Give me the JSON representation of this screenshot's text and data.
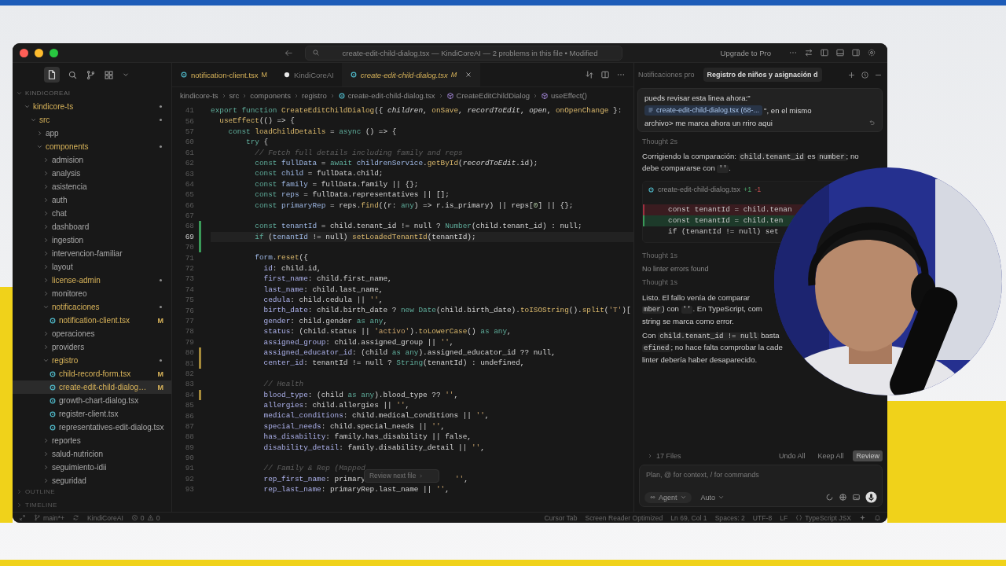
{
  "window": {
    "title": "create-edit-child-dialog.tsx — KindiCoreAI — 2 problems in this file • Modified",
    "upgrade_label": "Upgrade to Pro"
  },
  "explorer": {
    "title": "KINDICOREAI",
    "tree": [
      {
        "name": "kindicore-ts",
        "kind": "folder",
        "expanded": true,
        "modified": true,
        "selected": false,
        "children": [
          {
            "name": "src",
            "kind": "folder",
            "expanded": true,
            "modified": true,
            "selected": false,
            "children": [
              {
                "name": "app",
                "kind": "folder",
                "expanded": false,
                "modified": false,
                "selected": false
              },
              {
                "name": "components",
                "kind": "folder",
                "expanded": true,
                "modified": true,
                "selected": false,
                "children": [
                  {
                    "name": "admision",
                    "kind": "folder",
                    "expanded": false,
                    "modified": false,
                    "selected": false
                  },
                  {
                    "name": "analysis",
                    "kind": "folder",
                    "expanded": false,
                    "modified": false,
                    "selected": false
                  },
                  {
                    "name": "asistencia",
                    "kind": "folder",
                    "expanded": false,
                    "modified": false,
                    "selected": false
                  },
                  {
                    "name": "auth",
                    "kind": "folder",
                    "expanded": false,
                    "modified": false,
                    "selected": false
                  },
                  {
                    "name": "chat",
                    "kind": "folder",
                    "expanded": false,
                    "modified": false,
                    "selected": false
                  },
                  {
                    "name": "dashboard",
                    "kind": "folder",
                    "expanded": false,
                    "modified": false,
                    "selected": false
                  },
                  {
                    "name": "ingestion",
                    "kind": "folder",
                    "expanded": false,
                    "modified": false,
                    "selected": false
                  },
                  {
                    "name": "intervencion-familiar",
                    "kind": "folder",
                    "expanded": false,
                    "modified": false,
                    "selected": false
                  },
                  {
                    "name": "layout",
                    "kind": "folder",
                    "expanded": false,
                    "modified": false,
                    "selected": false
                  },
                  {
                    "name": "license-admin",
                    "kind": "folder",
                    "expanded": false,
                    "modified": true,
                    "selected": false
                  },
                  {
                    "name": "monitoreo",
                    "kind": "folder",
                    "expanded": false,
                    "modified": false,
                    "selected": false
                  },
                  {
                    "name": "notificaciones",
                    "kind": "folder",
                    "expanded": true,
                    "modified": true,
                    "selected": false,
                    "children": [
                      {
                        "name": "notification-client.tsx",
                        "kind": "file",
                        "modified": true,
                        "badge": "M",
                        "selected": false
                      }
                    ]
                  },
                  {
                    "name": "operaciones",
                    "kind": "folder",
                    "expanded": false,
                    "modified": false,
                    "selected": false
                  },
                  {
                    "name": "providers",
                    "kind": "folder",
                    "expanded": false,
                    "modified": false,
                    "selected": false
                  },
                  {
                    "name": "registro",
                    "kind": "folder",
                    "expanded": true,
                    "modified": true,
                    "selected": false,
                    "children": [
                      {
                        "name": "child-record-form.tsx",
                        "kind": "file",
                        "modified": true,
                        "badge": "M",
                        "selected": false
                      },
                      {
                        "name": "create-edit-child-dialog…",
                        "kind": "file",
                        "modified": true,
                        "badge": "M",
                        "selected": true
                      },
                      {
                        "name": "growth-chart-dialog.tsx",
                        "kind": "file",
                        "modified": false,
                        "selected": false
                      },
                      {
                        "name": "register-client.tsx",
                        "kind": "file",
                        "modified": false,
                        "selected": false
                      },
                      {
                        "name": "representatives-edit-dialog.tsx",
                        "kind": "file",
                        "modified": false,
                        "selected": false
                      }
                    ]
                  },
                  {
                    "name": "reportes",
                    "kind": "folder",
                    "expanded": false,
                    "modified": false,
                    "selected": false
                  },
                  {
                    "name": "salud-nutricion",
                    "kind": "folder",
                    "expanded": false,
                    "modified": false,
                    "selected": false
                  },
                  {
                    "name": "seguimiento-idii",
                    "kind": "folder",
                    "expanded": false,
                    "modified": false,
                    "selected": false
                  },
                  {
                    "name": "seguridad",
                    "kind": "folder",
                    "expanded": false,
                    "modified": false,
                    "selected": false
                  }
                ]
              }
            ]
          }
        ]
      }
    ],
    "sections": [
      {
        "label": "OUTLINE"
      },
      {
        "label": "TIMELINE"
      }
    ]
  },
  "editor": {
    "tabs": [
      {
        "label": "notification-client.tsx",
        "badge": "M",
        "kind": "file",
        "modified": true,
        "selected": false
      },
      {
        "label": "KindiCoreAI",
        "kind": "agent",
        "modified": false,
        "selected": false
      },
      {
        "label": "create-edit-child-dialog.tsx",
        "badge": "M",
        "kind": "file",
        "modified": true,
        "selected": true
      }
    ],
    "breadcrumb": [
      {
        "label": "kindicore-ts",
        "kind": "folder"
      },
      {
        "label": "src",
        "kind": "folder"
      },
      {
        "label": "components",
        "kind": "folder"
      },
      {
        "label": "registro",
        "kind": "folder"
      },
      {
        "label": "create-edit-child-dialog.tsx",
        "kind": "file"
      },
      {
        "label": "CreateEditChildDialog",
        "kind": "symbol"
      },
      {
        "label": "useEffect()",
        "kind": "symbol"
      }
    ],
    "lines": [
      {
        "number": "41",
        "added": false,
        "modified": false,
        "current": false,
        "tokens": [
          {
            "kind": "kw",
            "text": "export function "
          },
          {
            "kind": "fn",
            "text": "CreateEditChildDialog"
          },
          {
            "kind": "plain",
            "text": "({ "
          },
          {
            "kind": "param",
            "text": "children"
          },
          {
            "kind": "plain",
            "text": ", "
          },
          {
            "kind": "fn",
            "text": "onSave"
          },
          {
            "kind": "plain",
            "text": ", "
          },
          {
            "kind": "param",
            "text": "recordToEdit"
          },
          {
            "kind": "plain",
            "text": ", "
          },
          {
            "kind": "param",
            "text": "open"
          },
          {
            "kind": "plain",
            "text": ", "
          },
          {
            "kind": "fn",
            "text": "onOpenChange"
          },
          {
            "kind": "plain",
            "text": " }:"
          }
        ]
      },
      {
        "number": "56",
        "added": false,
        "modified": false,
        "current": false,
        "tokens": [
          {
            "kind": "fn",
            "text": "  useEffect"
          },
          {
            "kind": "plain",
            "text": "(() => {"
          }
        ]
      },
      {
        "number": "57",
        "added": false,
        "modified": false,
        "current": false,
        "tokens": [
          {
            "kind": "kw",
            "text": "    const "
          },
          {
            "kind": "fn",
            "text": "loadChildDetails"
          },
          {
            "kind": "plain",
            "text": " = "
          },
          {
            "kind": "kw",
            "text": "async"
          },
          {
            "kind": "plain",
            "text": " () => {"
          }
        ]
      },
      {
        "number": "60",
        "added": false,
        "modified": false,
        "current": false,
        "tokens": [
          {
            "kind": "kw",
            "text": "        try"
          },
          {
            "kind": "plain",
            "text": " {"
          }
        ]
      },
      {
        "number": "61",
        "added": false,
        "modified": false,
        "current": false,
        "tokens": [
          {
            "kind": "cmt",
            "text": "          // Fetch full details including family and reps"
          }
        ]
      },
      {
        "number": "62",
        "added": false,
        "modified": false,
        "current": false,
        "tokens": [
          {
            "kind": "kw",
            "text": "          const "
          },
          {
            "kind": "var",
            "text": "fullData"
          },
          {
            "kind": "plain",
            "text": " = "
          },
          {
            "kind": "kw",
            "text": "await "
          },
          {
            "kind": "var",
            "text": "childrenService"
          },
          {
            "kind": "plain",
            "text": "."
          },
          {
            "kind": "fn",
            "text": "getById"
          },
          {
            "kind": "plain",
            "text": "("
          },
          {
            "kind": "param",
            "text": "recordToEdit"
          },
          {
            "kind": "plain",
            "text": ".id);"
          }
        ]
      },
      {
        "number": "63",
        "added": false,
        "modified": false,
        "current": false,
        "tokens": [
          {
            "kind": "kw",
            "text": "          const "
          },
          {
            "kind": "var",
            "text": "child"
          },
          {
            "kind": "plain",
            "text": " = fullData.child;"
          }
        ]
      },
      {
        "number": "64",
        "added": false,
        "modified": false,
        "current": false,
        "tokens": [
          {
            "kind": "kw",
            "text": "          const "
          },
          {
            "kind": "var",
            "text": "family"
          },
          {
            "kind": "plain",
            "text": " = fullData.family || {};"
          }
        ]
      },
      {
        "number": "65",
        "added": false,
        "modified": false,
        "current": false,
        "tokens": [
          {
            "kind": "kw",
            "text": "          const "
          },
          {
            "kind": "var",
            "text": "reps"
          },
          {
            "kind": "plain",
            "text": " = fullData.representatives || [];"
          }
        ]
      },
      {
        "number": "66",
        "added": false,
        "modified": false,
        "current": false,
        "tokens": [
          {
            "kind": "kw",
            "text": "          const "
          },
          {
            "kind": "var",
            "text": "primaryRep"
          },
          {
            "kind": "plain",
            "text": " = reps."
          },
          {
            "kind": "fn",
            "text": "find"
          },
          {
            "kind": "plain",
            "text": "((r: "
          },
          {
            "kind": "type",
            "text": "any"
          },
          {
            "kind": "plain",
            "text": ") => r.is_primary) || reps["
          },
          {
            "kind": "num",
            "text": "0"
          },
          {
            "kind": "plain",
            "text": "] || {};"
          }
        ]
      },
      {
        "number": "67",
        "added": false,
        "modified": false,
        "current": false
      },
      {
        "number": "68",
        "added": true,
        "modified": false,
        "current": false,
        "tokens": [
          {
            "kind": "kw",
            "text": "          const "
          },
          {
            "kind": "var",
            "text": "tenantId"
          },
          {
            "kind": "plain",
            "text": " = child.tenant_id != null ? "
          },
          {
            "kind": "type",
            "text": "Number"
          },
          {
            "kind": "plain",
            "text": "(child.tenant_id) : null;"
          }
        ]
      },
      {
        "number": "69",
        "added": true,
        "modified": false,
        "current": true,
        "tokens": [
          {
            "kind": "kw",
            "text": "          if"
          },
          {
            "kind": "plain",
            "text": " ("
          },
          {
            "kind": "var",
            "text": "tenantId"
          },
          {
            "kind": "plain",
            "text": " != null) "
          },
          {
            "kind": "fn",
            "text": "setLoadedTenantId"
          },
          {
            "kind": "plain",
            "text": "(tenantId);"
          }
        ]
      },
      {
        "number": "70",
        "added": true,
        "modified": false,
        "current": false
      },
      {
        "number": "71",
        "added": false,
        "modified": false,
        "current": false,
        "tokens": [
          {
            "kind": "var",
            "text": "          form"
          },
          {
            "kind": "plain",
            "text": "."
          },
          {
            "kind": "fn",
            "text": "reset"
          },
          {
            "kind": "plain",
            "text": "({"
          }
        ]
      },
      {
        "number": "72",
        "added": false,
        "modified": false,
        "current": false,
        "tokens": [
          {
            "kind": "prop",
            "text": "            id"
          },
          {
            "kind": "plain",
            "text": ": child.id,"
          }
        ]
      },
      {
        "number": "73",
        "added": false,
        "modified": false,
        "current": false,
        "tokens": [
          {
            "kind": "prop",
            "text": "            first_name"
          },
          {
            "kind": "plain",
            "text": ": child.first_name,"
          }
        ]
      },
      {
        "number": "74",
        "added": false,
        "modified": false,
        "current": false,
        "tokens": [
          {
            "kind": "prop",
            "text": "            last_name"
          },
          {
            "kind": "plain",
            "text": ": child.last_name,"
          }
        ]
      },
      {
        "number": "75",
        "added": false,
        "modified": false,
        "current": false,
        "tokens": [
          {
            "kind": "prop",
            "text": "            cedula"
          },
          {
            "kind": "plain",
            "text": ": child.cedula || "
          },
          {
            "kind": "str",
            "text": "''"
          },
          {
            "kind": "plain",
            "text": ","
          }
        ]
      },
      {
        "number": "76",
        "added": false,
        "modified": false,
        "current": false,
        "tokens": [
          {
            "kind": "prop",
            "text": "            birth_date"
          },
          {
            "kind": "plain",
            "text": ": child.birth_date ? "
          },
          {
            "kind": "kw",
            "text": "new "
          },
          {
            "kind": "type",
            "text": "Date"
          },
          {
            "kind": "plain",
            "text": "(child.birth_date)."
          },
          {
            "kind": "fn",
            "text": "toISOString"
          },
          {
            "kind": "plain",
            "text": "()."
          },
          {
            "kind": "fn",
            "text": "split"
          },
          {
            "kind": "plain",
            "text": "("
          },
          {
            "kind": "str",
            "text": "'T'"
          },
          {
            "kind": "plain",
            "text": ")["
          }
        ]
      },
      {
        "number": "77",
        "added": false,
        "modified": false,
        "current": false,
        "tokens": [
          {
            "kind": "prop",
            "text": "            gender"
          },
          {
            "kind": "plain",
            "text": ": child.gender "
          },
          {
            "kind": "kw",
            "text": "as any"
          },
          {
            "kind": "plain",
            "text": ","
          }
        ]
      },
      {
        "number": "78",
        "added": false,
        "modified": false,
        "current": false,
        "tokens": [
          {
            "kind": "prop",
            "text": "            status"
          },
          {
            "kind": "plain",
            "text": ": (child.status || "
          },
          {
            "kind": "str",
            "text": "'activo'"
          },
          {
            "kind": "plain",
            "text": ")."
          },
          {
            "kind": "fn",
            "text": "toLowerCase"
          },
          {
            "kind": "plain",
            "text": "() "
          },
          {
            "kind": "kw",
            "text": "as any"
          },
          {
            "kind": "plain",
            "text": ","
          }
        ]
      },
      {
        "number": "79",
        "added": false,
        "modified": false,
        "current": false,
        "tokens": [
          {
            "kind": "prop",
            "text": "            assigned_group"
          },
          {
            "kind": "plain",
            "text": ": child.assigned_group || "
          },
          {
            "kind": "str",
            "text": "''"
          },
          {
            "kind": "plain",
            "text": ","
          }
        ]
      },
      {
        "number": "80",
        "added": false,
        "modified": true,
        "current": false,
        "tokens": [
          {
            "kind": "prop",
            "text": "            assigned_educator_id"
          },
          {
            "kind": "plain",
            "text": ": (child "
          },
          {
            "kind": "kw",
            "text": "as any"
          },
          {
            "kind": "plain",
            "text": ").assigned_educator_id ?? null,"
          }
        ]
      },
      {
        "number": "81",
        "added": false,
        "modified": true,
        "current": false,
        "tokens": [
          {
            "kind": "prop",
            "text": "            center_id"
          },
          {
            "kind": "plain",
            "text": ": tenantId != null ? "
          },
          {
            "kind": "type",
            "text": "String"
          },
          {
            "kind": "plain",
            "text": "(tenantId) : undefined,"
          }
        ]
      },
      {
        "number": "82",
        "added": false,
        "modified": false,
        "current": false
      },
      {
        "number": "83",
        "added": false,
        "modified": false,
        "current": false,
        "tokens": [
          {
            "kind": "cmt",
            "text": "            // Health"
          }
        ]
      },
      {
        "number": "84",
        "added": false,
        "modified": true,
        "current": false,
        "tokens": [
          {
            "kind": "prop",
            "text": "            blood_type"
          },
          {
            "kind": "plain",
            "text": ": (child "
          },
          {
            "kind": "kw",
            "text": "as any"
          },
          {
            "kind": "plain",
            "text": ").blood_type ?? "
          },
          {
            "kind": "str",
            "text": "''"
          },
          {
            "kind": "plain",
            "text": ","
          }
        ]
      },
      {
        "number": "85",
        "added": false,
        "modified": false,
        "current": false,
        "tokens": [
          {
            "kind": "prop",
            "text": "            allergies"
          },
          {
            "kind": "plain",
            "text": ": child.allergies || "
          },
          {
            "kind": "str",
            "text": "''"
          },
          {
            "kind": "plain",
            "text": ","
          }
        ]
      },
      {
        "number": "86",
        "added": false,
        "modified": false,
        "current": false,
        "tokens": [
          {
            "kind": "prop",
            "text": "            medical_conditions"
          },
          {
            "kind": "plain",
            "text": ": child.medical_conditions || "
          },
          {
            "kind": "str",
            "text": "''"
          },
          {
            "kind": "plain",
            "text": ","
          }
        ]
      },
      {
        "number": "87",
        "added": false,
        "modified": false,
        "current": false,
        "tokens": [
          {
            "kind": "prop",
            "text": "            special_needs"
          },
          {
            "kind": "plain",
            "text": ": child.special_needs || "
          },
          {
            "kind": "str",
            "text": "''"
          },
          {
            "kind": "plain",
            "text": ","
          }
        ]
      },
      {
        "number": "88",
        "added": false,
        "modified": false,
        "current": false,
        "tokens": [
          {
            "kind": "prop",
            "text": "            has_disability"
          },
          {
            "kind": "plain",
            "text": ": family.has_disability || false,"
          }
        ]
      },
      {
        "number": "89",
        "added": false,
        "modified": false,
        "current": false,
        "tokens": [
          {
            "kind": "prop",
            "text": "            disability_detail"
          },
          {
            "kind": "plain",
            "text": ": family.disability_detail || "
          },
          {
            "kind": "str",
            "text": "''"
          },
          {
            "kind": "plain",
            "text": ","
          }
        ]
      },
      {
        "number": "90",
        "added": false,
        "modified": false,
        "current": false
      },
      {
        "number": "91",
        "added": false,
        "modified": false,
        "current": false,
        "tokens": [
          {
            "kind": "cmt",
            "text": "            // Family & Rep (Mapped"
          }
        ]
      },
      {
        "number": "92",
        "added": false,
        "modified": false,
        "current": false,
        "tokens": [
          {
            "kind": "prop",
            "text": "            rep_first_name"
          },
          {
            "kind": "plain",
            "text": ": primary"
          },
          {
            "kind": "covered"
          },
          {
            "kind": "str",
            "text": "''"
          },
          {
            "kind": "plain",
            "text": ","
          }
        ]
      },
      {
        "number": "93",
        "added": false,
        "modified": false,
        "current": false,
        "tokens": [
          {
            "kind": "prop",
            "text": "            rep_last_name"
          },
          {
            "kind": "plain",
            "text": ": primaryRep.last_name || "
          },
          {
            "kind": "str",
            "text": "''"
          },
          {
            "kind": "plain",
            "text": ","
          }
        ]
      }
    ],
    "tooltip": "Review next file"
  },
  "chat": {
    "tabs": [
      {
        "label": "Notificaciones pro",
        "selected": false
      },
      {
        "label": "Registro de niños y asignación d",
        "selected": true
      }
    ],
    "user_message": [
      [
        {
          "kind": "text",
          "text": "pueds revisar esta linea ahora:\""
        }
      ],
      [
        {
          "kind": "chip",
          "text": "create-edit-child-dialog.tsx (68-..."
        },
        {
          "kind": "text",
          "text": "\", en el mismo"
        }
      ],
      [
        {
          "kind": "text",
          "text": "archivo> me marca ahora un rriro aqui"
        }
      ]
    ],
    "items": [
      {
        "kind": "thought",
        "text": "Thought 2s"
      },
      {
        "kind": "paragraph",
        "lines": [
          [
            {
              "kind": "text",
              "text": "Corrigiendo la comparación: "
            },
            {
              "kind": "code",
              "text": "child.tenant_id"
            },
            {
              "kind": "text",
              "text": " es "
            },
            {
              "kind": "code",
              "text": "number"
            },
            {
              "kind": "text",
              "text": "; no"
            }
          ],
          [
            {
              "kind": "text",
              "text": "debe compararse con "
            },
            {
              "kind": "code",
              "text": "''"
            },
            {
              "kind": "text",
              "text": "."
            }
          ]
        ]
      },
      {
        "kind": "diff",
        "file": "create-edit-child-dialog.tsx",
        "added": "+1",
        "removed": "-1",
        "lines": [
          {
            "removed": true,
            "added": false,
            "text": "const tenantId = child.tenan"
          },
          {
            "removed": false,
            "added": true,
            "text": "const tenantId = child.ten"
          },
          {
            "removed": false,
            "added": false,
            "text": "if (tenantId != null) set"
          }
        ]
      },
      {
        "kind": "thought",
        "text": "Thought 1s"
      },
      {
        "kind": "note",
        "text": "No linter errors found"
      },
      {
        "kind": "thought",
        "text": "Thought 1s"
      },
      {
        "kind": "paragraph",
        "lines": [
          [
            {
              "kind": "text",
              "text": "Listo. El fallo venía de comparar"
            }
          ],
          [
            {
              "kind": "code",
              "text": "mber"
            },
            {
              "kind": "text",
              "text": ") con "
            },
            {
              "kind": "code",
              "text": "''"
            },
            {
              "kind": "text",
              "text": ". En TypeScript, com"
            }
          ],
          [
            {
              "kind": "text",
              "text": "string se marca como error."
            }
          ]
        ]
      },
      {
        "kind": "paragraph",
        "lines": [
          [
            {
              "kind": "text",
              "text": "Con "
            },
            {
              "kind": "code",
              "text": "child.tenant_id != null"
            },
            {
              "kind": "text",
              "text": " basta"
            }
          ],
          [
            {
              "kind": "code",
              "text": "efined"
            },
            {
              "kind": "text",
              "text": "; no hace falta comprobar la cade"
            }
          ],
          [
            {
              "kind": "text",
              "text": "linter debería haber desaparecido."
            }
          ]
        ]
      }
    ],
    "files": "17 Files",
    "actions": [
      {
        "label": "Undo All",
        "primary": false
      },
      {
        "label": "Keep All",
        "primary": false
      },
      {
        "label": "Review",
        "primary": true
      }
    ],
    "placeholder": "Plan, @ for context, / for commands",
    "mode": "Agent",
    "model": "Auto"
  },
  "status_bar": {
    "branch": "main*+",
    "project": "KindiCoreAI",
    "errors": "0",
    "warnings": "0",
    "right": [
      "Cursor Tab",
      "Screen Reader Optimized",
      "Ln 69, Col 1",
      "Spaces: 2",
      "UTF-8",
      "LF"
    ],
    "language": "TypeScript JSX"
  }
}
